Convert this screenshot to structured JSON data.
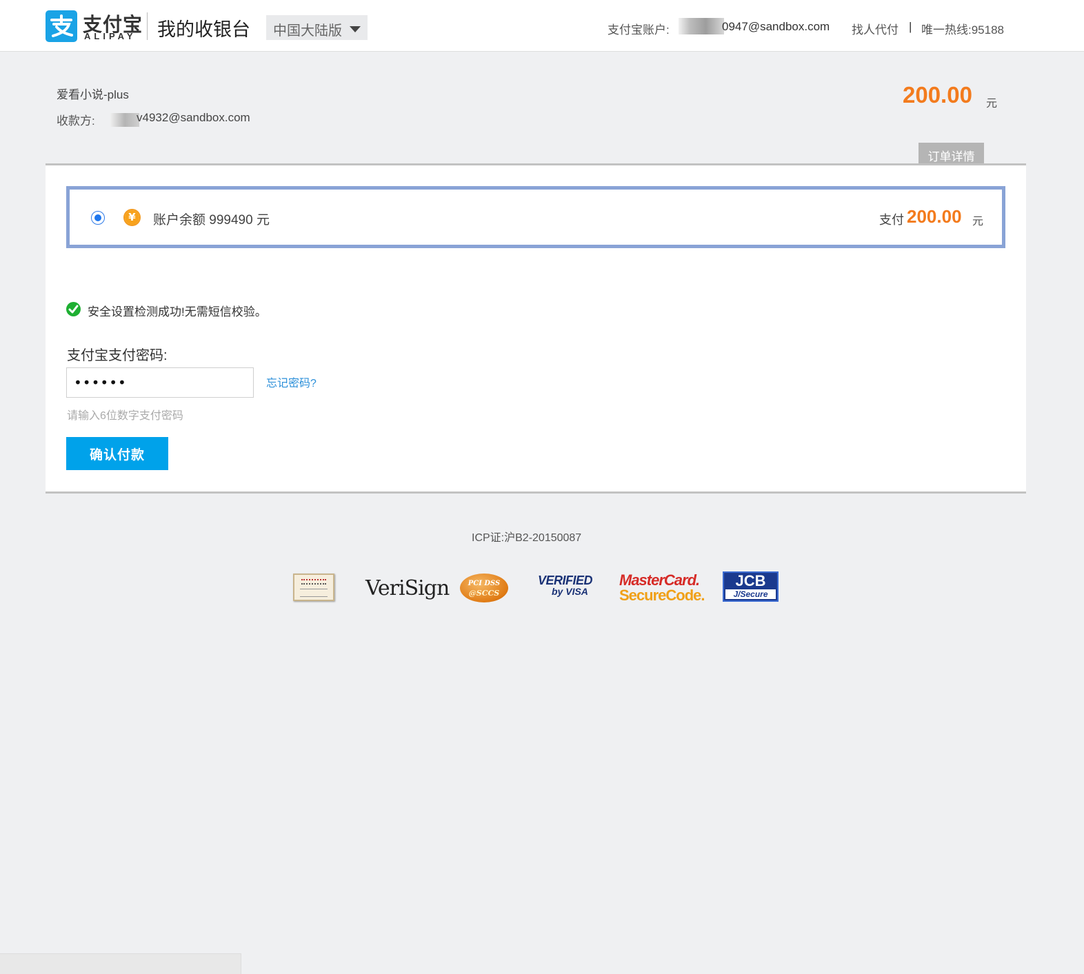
{
  "header": {
    "logo_cn": "支付宝",
    "logo_en": "ALIPAY",
    "title": "我的收银台",
    "region": "中国大陆版",
    "account_label": "支付宝账户:",
    "account_value": "0947@sandbox.com",
    "find_pay": "找人代付",
    "separator": "|",
    "hotline": "唯一热线:95188"
  },
  "order": {
    "merchant": "爱看小说-plus",
    "payee_label": "收款方:",
    "payee_value": "v4932@sandbox.com",
    "amount": "200.00",
    "unit": "元",
    "detail_tab": "订单详情"
  },
  "payment_method": {
    "selected": true,
    "icon": "yuan-balance-icon",
    "balance_label": "账户余额 999490 元",
    "pay_label": "支付",
    "pay_amount": "200.00",
    "pay_unit": "元"
  },
  "security": {
    "message": "安全设置检测成功!无需短信校验。"
  },
  "password": {
    "label": "支付宝支付密码:",
    "value": "••••••",
    "forgot": "忘记密码?",
    "hint": "请输入6位数字支付密码"
  },
  "confirm_button": "确认付款",
  "footer": {
    "icp": "ICP证:沪B2-20150087",
    "badges": {
      "verisign": "VeriSign",
      "pcidss_l1": "PCI DSS",
      "pcidss_l2": "@SCCS",
      "vbv_l1": "VERIFIED",
      "vbv_l2": "by VISA",
      "mc_l1": "MasterCard.",
      "mc_l2": "SecureCode.",
      "jcb_l1": "JCB",
      "jcb_l2": "J/Secure"
    }
  },
  "colors": {
    "brand_blue": "#1aa3e6",
    "amount_orange": "#f37b1d",
    "button_blue": "#00a2ea",
    "selection_border": "#89a3d6",
    "success_green": "#1eaf32",
    "link_blue": "#2b8fd9"
  }
}
